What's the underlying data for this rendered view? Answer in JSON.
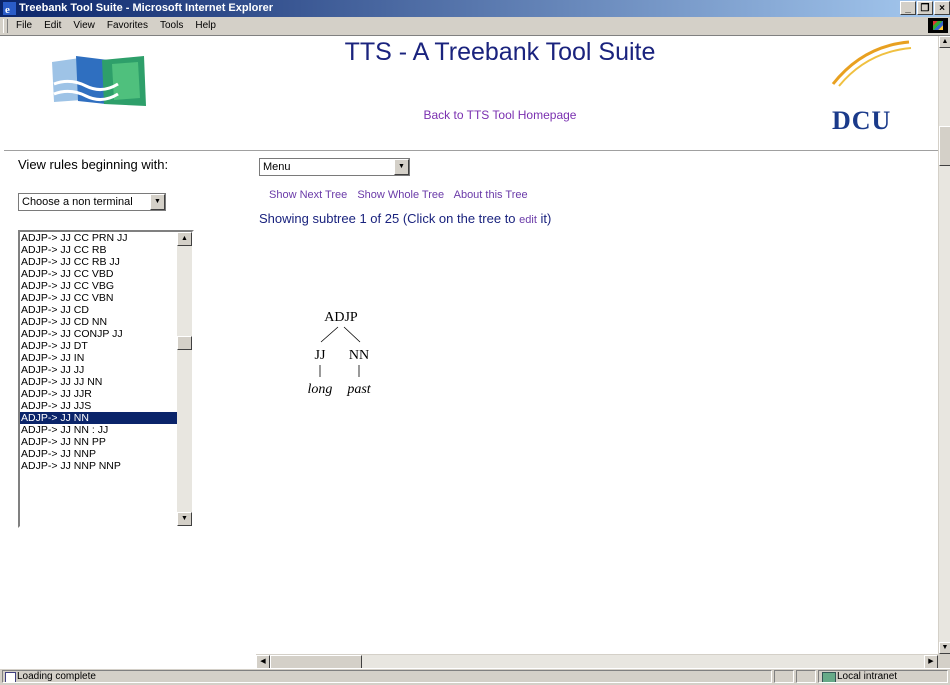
{
  "window": {
    "title": "Treebank Tool Suite - Microsoft Internet Explorer",
    "buttons": [
      "_",
      "8",
      "x"
    ]
  },
  "menubar": {
    "items": [
      {
        "label": "File"
      },
      {
        "label": "Edit"
      },
      {
        "label": "View"
      },
      {
        "label": "Favorites"
      },
      {
        "label": "Tools"
      },
      {
        "label": "Help"
      }
    ]
  },
  "header": {
    "title": "TTS - A Treebank Tool Suite",
    "back_link": "Back to TTS Tool Homepage",
    "logo_text": "DCU"
  },
  "left_panel": {
    "view_rules_label": "View rules beginning with:",
    "nonterminal_select": "Choose a non terminal",
    "rules": [
      "ADJP-> JJ CC PRN JJ",
      "ADJP-> JJ CC RB",
      "ADJP-> JJ CC RB JJ",
      "ADJP-> JJ CC VBD",
      "ADJP-> JJ CC VBG",
      "ADJP-> JJ CC VBN",
      "ADJP-> JJ CD",
      "ADJP-> JJ CD NN",
      "ADJP-> JJ CONJP JJ",
      "ADJP-> JJ DT",
      "ADJP-> JJ IN",
      "ADJP-> JJ JJ",
      "ADJP-> JJ JJ NN",
      "ADJP-> JJ JJR",
      "ADJP-> JJ JJS",
      "ADJP-> JJ NN",
      "ADJP-> JJ NN : JJ",
      "ADJP-> JJ NN PP",
      "ADJP-> JJ NNP",
      "ADJP-> JJ NNP NNP"
    ],
    "selected_index": 15
  },
  "main": {
    "menu_select": "Menu",
    "links": {
      "next": "Show Next Tree",
      "whole": "Show Whole Tree",
      "about": "About this Tree"
    },
    "showing_prefix": "Showing subtree 1 of 25 (Click on the tree to ",
    "showing_edit": "edit",
    "showing_suffix": " it)",
    "tree": {
      "root": "ADJP",
      "children": [
        {
          "tag": "JJ",
          "word": "long"
        },
        {
          "tag": "NN",
          "word": "past"
        }
      ]
    }
  },
  "statusbar": {
    "status": "Loading complete",
    "zone": "Local intranet"
  }
}
